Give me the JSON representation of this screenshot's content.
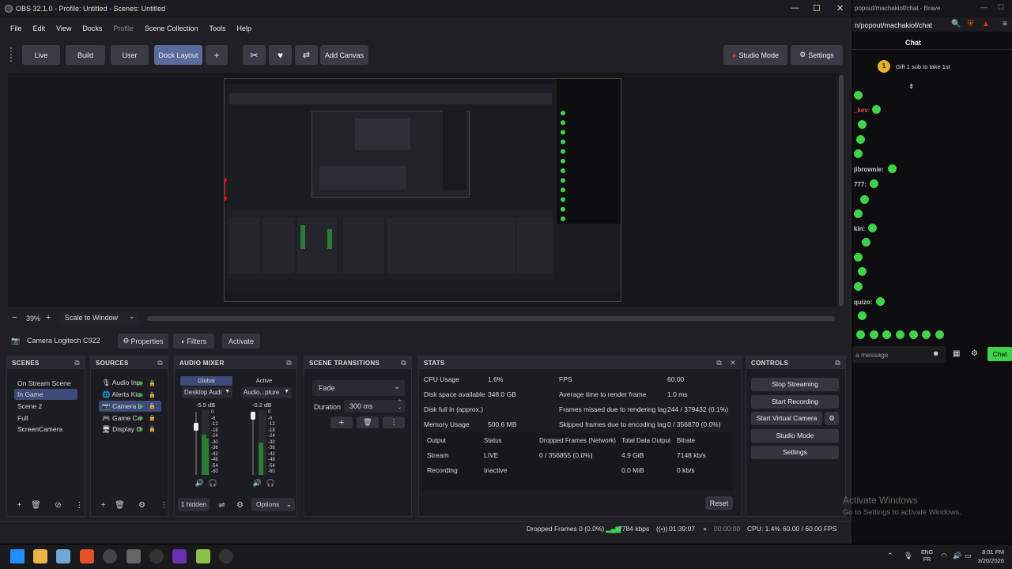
{
  "window": {
    "title": "OBS 32.1.0 - Profile: Untitled - Scenes: Untitled"
  },
  "menu": [
    "File",
    "Edit",
    "View",
    "Docks",
    "Profile",
    "Scene Collection",
    "Tools",
    "Help"
  ],
  "toolbar": {
    "tabs": [
      "Live",
      "Build",
      "User",
      "Dock Layout"
    ],
    "plus": "+",
    "add_canvas": "Add Canvas",
    "studio_mode": "Studio Mode",
    "settings": "Settings"
  },
  "zoom": {
    "value": "39%",
    "minus": "−",
    "plus": "+",
    "scale_mode": "Scale to Window"
  },
  "source_bar": {
    "name": "Camera Logitech C922",
    "properties": "Properties",
    "filters": "Filters",
    "activate": "Activate"
  },
  "scenes": {
    "title": "SCENES",
    "items": [
      "On Stream Scene",
      "In Game",
      "Scene 2",
      "Full ScreenCamera"
    ],
    "selected": 1
  },
  "sources": {
    "title": "SOURCES",
    "items": [
      "Audio Inp",
      "Alerts Kic",
      "Camera L",
      "Game Ca",
      "Display C"
    ],
    "selected": 2
  },
  "audio": {
    "title": "AUDIO MIXER",
    "tab_global": "Global",
    "tab_active": "Active",
    "ch1": {
      "name": "Desktop Audi",
      "db": "-5.5 dB",
      "level": 0.62
    },
    "ch2": {
      "name": "Audio...pture",
      "db": "-0.2 dB",
      "level": 0.5
    },
    "scale": [
      "0",
      "-6",
      "-12",
      "-18",
      "-24",
      "-30",
      "-36",
      "-42",
      "-48",
      "-54",
      "-60"
    ],
    "hidden": "1 hidden",
    "options": "Options"
  },
  "transitions": {
    "title": "SCENE TRANSITIONS",
    "type": "Fade",
    "duration_label": "Duration",
    "duration": "300 ms"
  },
  "stats": {
    "title": "STATS",
    "rows_left": [
      [
        "CPU Usage",
        "1.6%"
      ],
      [
        "Disk space available",
        "348.0 GB"
      ],
      [
        "Disk full in (approx.)",
        ""
      ],
      [
        "Memory Usage",
        "500.6 MB"
      ]
    ],
    "rows_right": [
      [
        "FPS",
        "60.00"
      ],
      [
        "Average time to render frame",
        "1.0 ms"
      ],
      [
        "Frames missed due to rendering lag",
        "244 / 379432 (0.1%)"
      ],
      [
        "Skipped frames due to encoding lag",
        "0 / 356870 (0.0%)"
      ]
    ],
    "table_head": [
      "Output",
      "Status",
      "Dropped Frames (Network)",
      "Total Data Output",
      "Bitrate"
    ],
    "table_rows": [
      [
        "Stream",
        "LIVE",
        "0 / 356855 (0.0%)",
        "4.9 GiB",
        "7148 kb/s"
      ],
      [
        "Recording",
        "Inactive",
        "",
        "0.0 MiB",
        "0 kb/s"
      ]
    ],
    "reset": "Reset"
  },
  "controls": {
    "title": "CONTROLS",
    "buttons": [
      "Stop Streaming",
      "Start Recording",
      "Start Virtual Camera",
      "Studio Mode",
      "Settings"
    ]
  },
  "status": {
    "dropped": "Dropped Frames 0 (0.0%)",
    "kbps": "7784 kbps",
    "live_time": "01:39:07",
    "rec_time": "00:00:00",
    "cpu": "CPU: 1.4%",
    "fps": "60.00 / 60.00 FPS"
  },
  "chat": {
    "browser_title": "popout/machakiof/chat - Brave",
    "url": "n/popout/machakiof/chat",
    "title": "Chat",
    "gift": "Gift 1 sub to take 1st",
    "badge": "1",
    "users": [
      "_kev:",
      "jibrownie:",
      "777:",
      "kin:",
      "quizo:"
    ],
    "placeholder": "a message",
    "send": "Chat"
  },
  "watermark": {
    "line1": "Activate Windows",
    "line2": "Go to Settings to activate Windows."
  },
  "taskbar": {
    "lang1": "ENG",
    "lang2": "FR",
    "time": "8:01 PM",
    "date": "3/20/2026"
  }
}
